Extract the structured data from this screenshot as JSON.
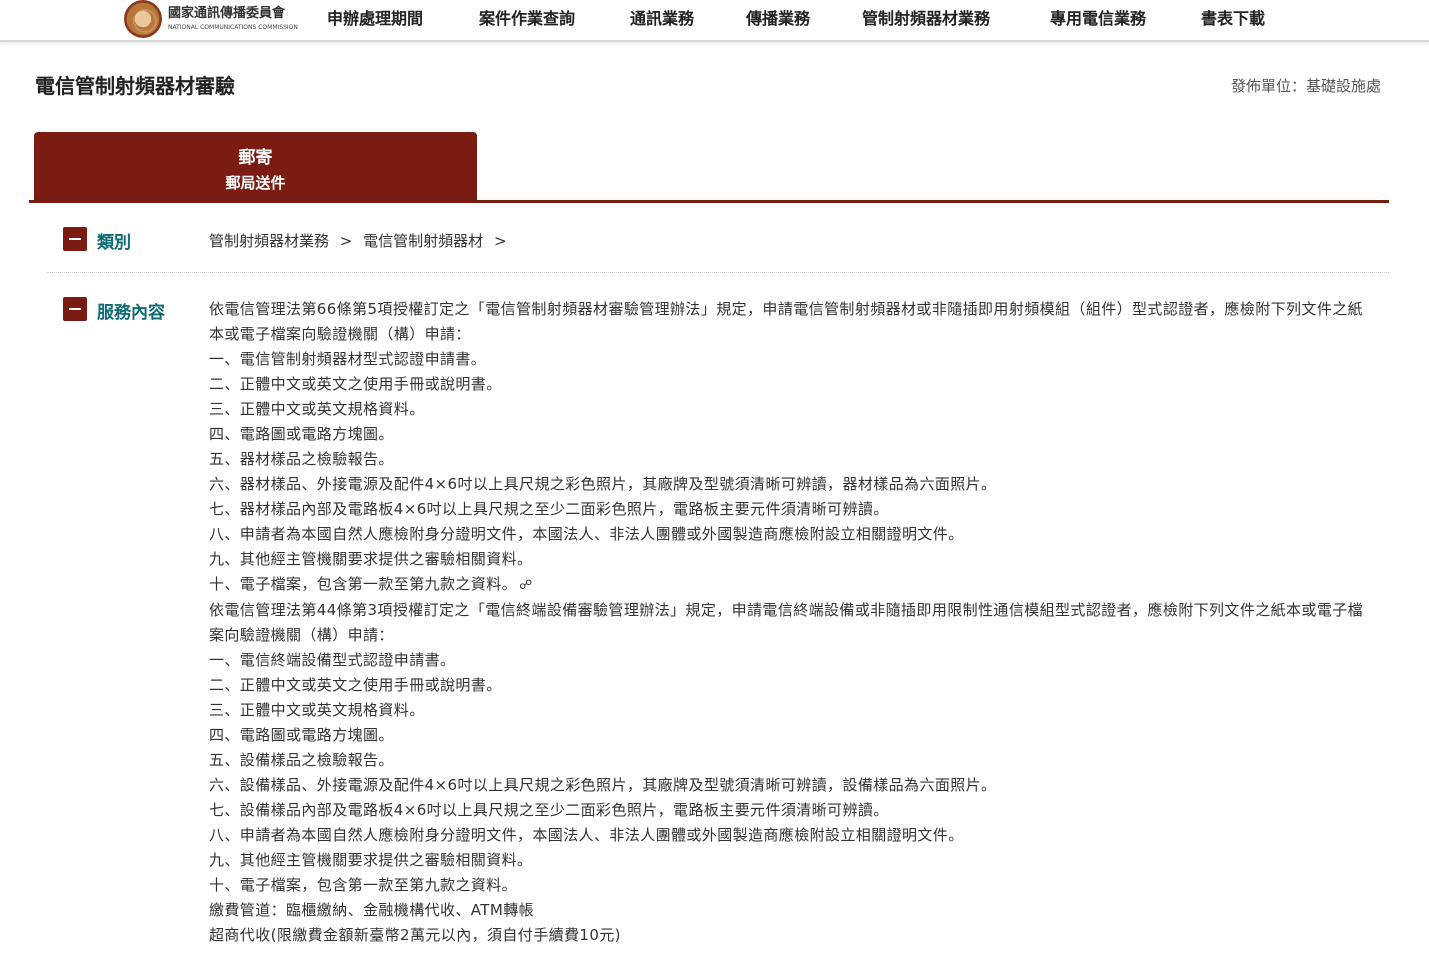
{
  "header": {
    "logo_cn": "國家通訊傳播委員會",
    "logo_en": "NATIONAL COMMUNICATIONS COMMISSION",
    "nav": [
      "申辦處理期間",
      "案件作業查詢",
      "通訊業務",
      "傳播業務",
      "管制射頻器材業務",
      "專用電信業務",
      "書表下載"
    ]
  },
  "page": {
    "title": "電信管制射頻器材審驗",
    "publisher": "發佈單位：基礎設施處"
  },
  "tab": {
    "main": "郵寄",
    "sub": "郵局送件"
  },
  "category": {
    "label": "類別",
    "breadcrumb": [
      "管制射頻器材業務",
      ">",
      "電信管制射頻器材",
      ">"
    ]
  },
  "service": {
    "label": "服務內容",
    "lines": [
      "依電信管理法第66條第5項授權訂定之「電信管制射頻器材審驗管理辦法」規定，申請電信管制射頻器材或非隨插即用射頻模組（組件）型式認證者，應檢附下列文件之紙本或電子檔案向驗證機關（構）申請：",
      "一、電信管制射頻器材型式認證申請書。",
      "二、正體中文或英文之使用手冊或說明書。",
      "三、正體中文或英文規格資料。",
      "四、電路圖或電路方塊圖。",
      "五、器材樣品之檢驗報告。",
      "六、器材樣品、外接電源及配件4×6吋以上具尺規之彩色照片，其廠牌及型號須清晰可辨讀，器材樣品為六面照片。",
      "七、器材樣品內部及電路板4×6吋以上具尺規之至少二面彩色照片，電路板主要元件須清晰可辨讀。",
      "八、申請者為本國自然人應檢附身分證明文件，本國法人、非法人團體或外國製造商應檢附設立相關證明文件。",
      "九、其他經主管機關要求提供之審驗相關資料。",
      "十、電子檔案，包含第一款至第九款之資料。",
      "依電信管理法第44條第3項授權訂定之「電信終端設備審驗管理辦法」規定，申請電信終端設備或非隨插即用限制性通信模組型式認證者，應檢附下列文件之紙本或電子檔案向驗證機關（構）申請：",
      "一、電信終端設備型式認證申請書。",
      "二、正體中文或英文之使用手冊或說明書。",
      "三、正體中文或英文規格資料。",
      "四、電路圖或電路方塊圖。",
      "五、設備樣品之檢驗報告。",
      "六、設備樣品、外接電源及配件4×6吋以上具尺規之彩色照片，其廠牌及型號須清晰可辨讀，設備樣品為六面照片。",
      "七、設備樣品內部及電路板4×6吋以上具尺規之至少二面彩色照片，電路板主要元件須清晰可辨讀。",
      "八、申請者為本國自然人應檢附身分證明文件，本國法人、非法人團體或外國製造商應檢附設立相關證明文件。",
      "九、其他經主管機關要求提供之審驗相關資料。",
      "十、電子檔案，包含第一款至第九款之資料。",
      "繳費管道：臨櫃繳納、金融機構代收、ATM轉帳",
      "超商代收(限繳費金額新臺幣2萬元以內，須自付手續費10元)"
    ]
  },
  "colors": {
    "accent": "#7b1c12",
    "label_teal": "#0e6a73"
  },
  "icons": {
    "link": "link-icon"
  }
}
